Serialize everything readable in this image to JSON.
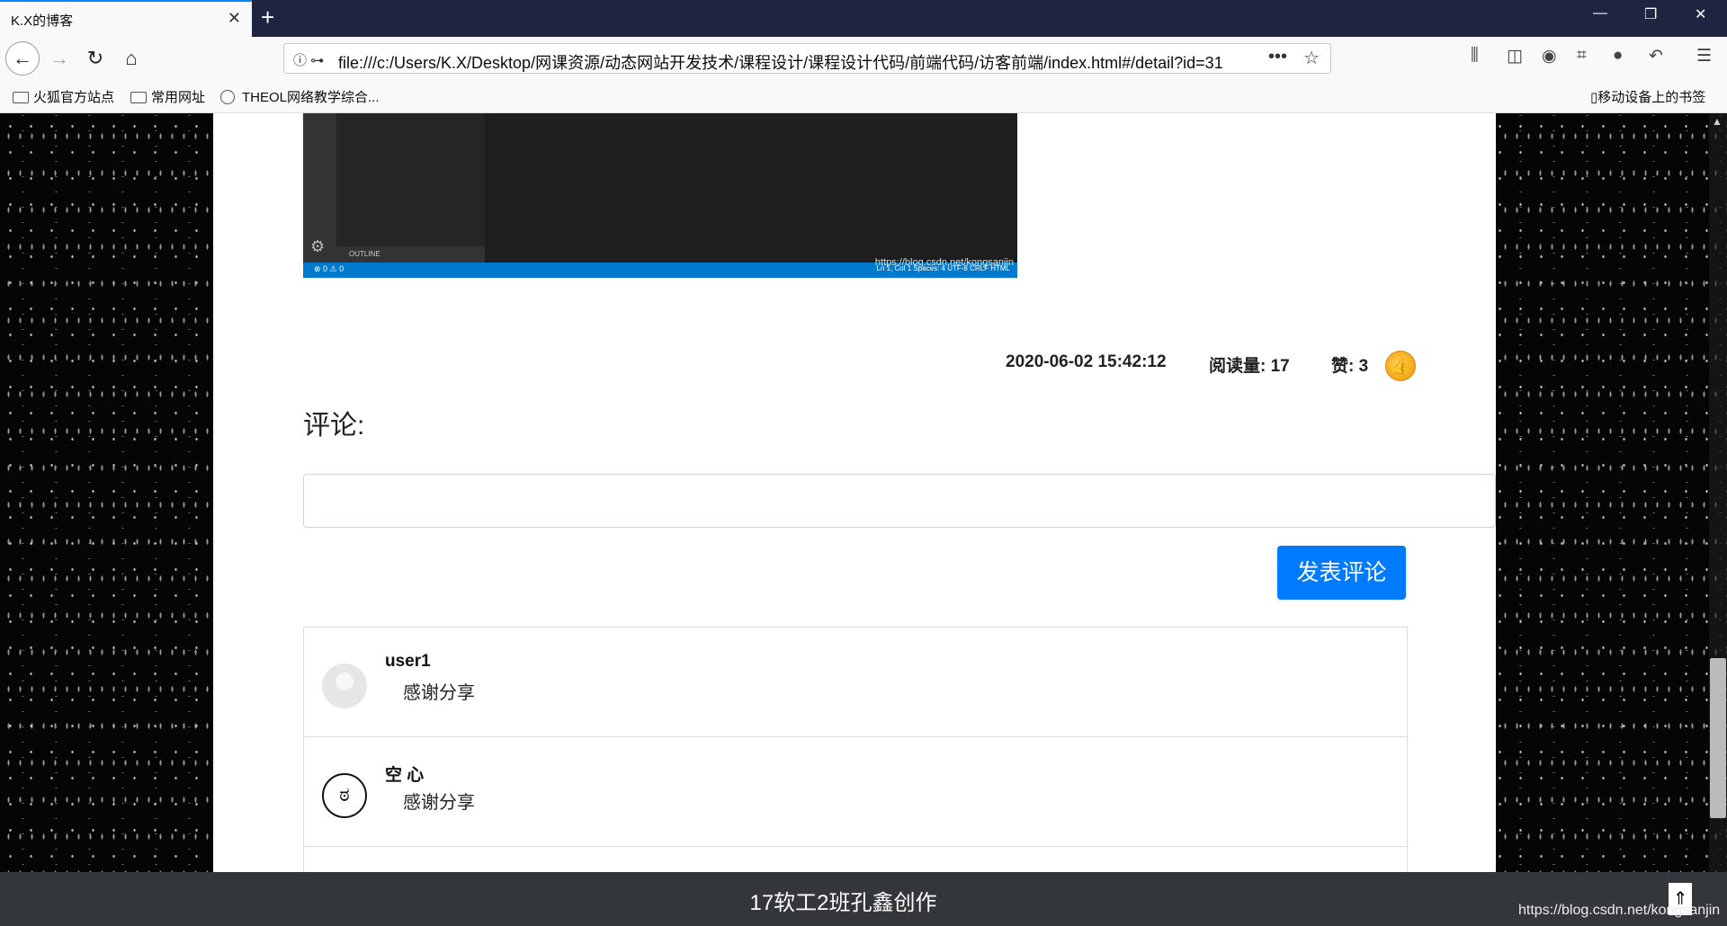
{
  "browser": {
    "tab_title": "K.X的博客",
    "tab_close": "✕",
    "new_tab": "+",
    "url": "file:///c:/Users/K.X/Desktop/网课资源/动态网站开发技术/课程设计/课程设计代码/前端代码/访客前端/index.html#/detail?id=31",
    "bookmarks": [
      "火狐官方站点",
      "常用网址",
      "THEOL网络教学综合..."
    ],
    "mobile_bookmarks": "移动设备上的书签"
  },
  "code_screenshot": {
    "outline_label": "OUTLINE",
    "status_left": "⊗ 0 ⚠ 0",
    "status_right": "Ln 1, Col 1    Spaces: 4    UTF-8    CRLF    HTML",
    "watermark": "https://blog.csdn.net/kongsanjin"
  },
  "post_meta": {
    "datetime": "2020-06-02 15:42:12",
    "reads": "阅读量: 17",
    "likes": "赞: 3"
  },
  "comments": {
    "title": "评论:",
    "input_value": "",
    "submit_label": "发表评论",
    "items": [
      {
        "user": "user1",
        "text": "感谢分享"
      },
      {
        "user": "空 心",
        "text": "感谢分享"
      }
    ]
  },
  "footer": {
    "text": "17软工2班孔鑫创作",
    "watermark": "https://blog.csdn.net/kongsanjin"
  },
  "icons": {
    "back": "arrow-left-icon",
    "forward": "arrow-right-icon",
    "reload": "reload-icon",
    "home": "home-icon",
    "like": "thumbs-up-icon",
    "to_top": "arrow-up-icon"
  }
}
